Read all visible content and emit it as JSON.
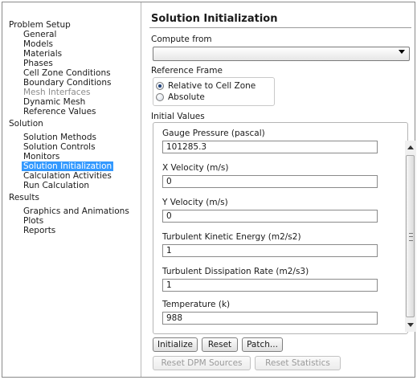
{
  "tree": {
    "groups": [
      {
        "label": "Problem Setup",
        "items": [
          "General",
          "Models",
          "Materials",
          "Phases",
          "Cell Zone Conditions",
          "Boundary Conditions",
          "Mesh Interfaces",
          "Dynamic Mesh",
          "Reference Values"
        ],
        "disabled": [
          "Mesh Interfaces"
        ]
      },
      {
        "label": "Solution",
        "items": [
          "Solution Methods",
          "Solution Controls",
          "Monitors",
          "Solution Initialization",
          "Calculation Activities",
          "Run Calculation"
        ],
        "selected": "Solution Initialization"
      },
      {
        "label": "Results",
        "items": [
          "Graphics and Animations",
          "Plots",
          "Reports"
        ]
      }
    ]
  },
  "panel": {
    "title": "Solution Initialization",
    "compute_from_label": "Compute from",
    "compute_from_value": "",
    "reference_frame_label": "Reference Frame",
    "reference_frame_options": [
      "Relative to Cell Zone",
      "Absolute"
    ],
    "reference_frame_selected": "Relative to Cell Zone",
    "initial_values_label": "Initial Values",
    "fields": [
      {
        "label": "Gauge Pressure (pascal)",
        "value": "101285.3"
      },
      {
        "label": "X Velocity (m/s)",
        "value": "0"
      },
      {
        "label": "Y Velocity (m/s)",
        "value": "0"
      },
      {
        "label": "Turbulent Kinetic Energy (m2/s2)",
        "value": "1"
      },
      {
        "label": "Turbulent Dissipation Rate (m2/s3)",
        "value": "1"
      },
      {
        "label": "Temperature (k)",
        "value": "988"
      }
    ],
    "buttons": {
      "initialize": "Initialize",
      "reset": "Reset",
      "patch": "Patch...",
      "reset_dpm": "Reset DPM Sources",
      "reset_statistics": "Reset Statistics"
    }
  },
  "colors": {
    "selection": "#3399ff",
    "disabled_text": "#8c8c8c"
  }
}
